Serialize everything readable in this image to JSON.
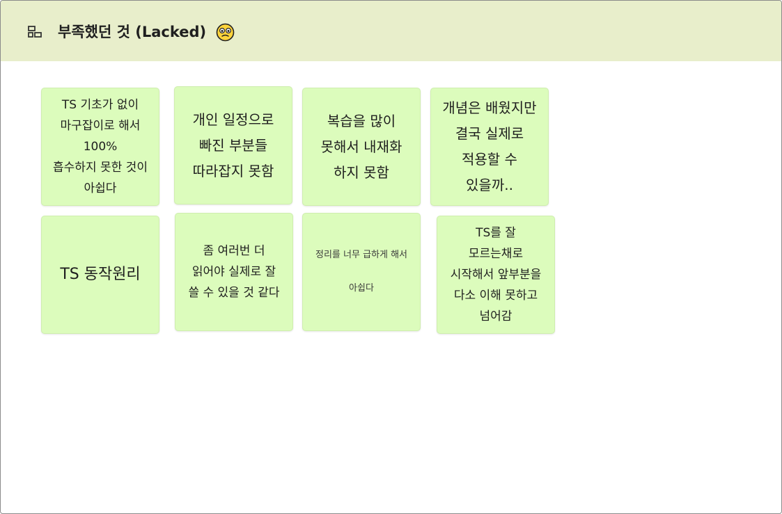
{
  "frame": {
    "title": "부족했던 것 (Lacked)",
    "icon": "frame-icon",
    "emoji": "emoji-face-icon",
    "header_color": "#e8eecb"
  },
  "stickies": [
    {
      "text": "TS 기초가 없이\n마구잡이로 해서\n100%\n흡수하지 못한 것이\n아쉽다",
      "color": "#dcfcbc"
    },
    {
      "text": "개인 일정으로\n빠진 부분들\n따라잡지 못함",
      "color": "#dcfcbc"
    },
    {
      "text": "복습을 많이\n못해서 내재화\n하지 못함",
      "color": "#dcfcbc"
    },
    {
      "text": "개념은 배웠지만\n결국 실제로\n적용할 수\n있을까..",
      "color": "#dcfcbc"
    },
    {
      "text": "TS 동작원리",
      "color": "#dcfcbc"
    },
    {
      "text": "좀 여러번 더\n읽어야 실제로 잘\n쓸 수 있을 것 같다",
      "color": "#dcfcbc"
    },
    {
      "text": "정리를 너무 급하게 해서\n\n아쉽다",
      "color": "#dcfcbc"
    },
    {
      "text": "TS를 잘\n모르는채로\n시작해서 앞부분을\n다소 이해 못하고\n넘어감",
      "color": "#dcfcbc"
    }
  ]
}
